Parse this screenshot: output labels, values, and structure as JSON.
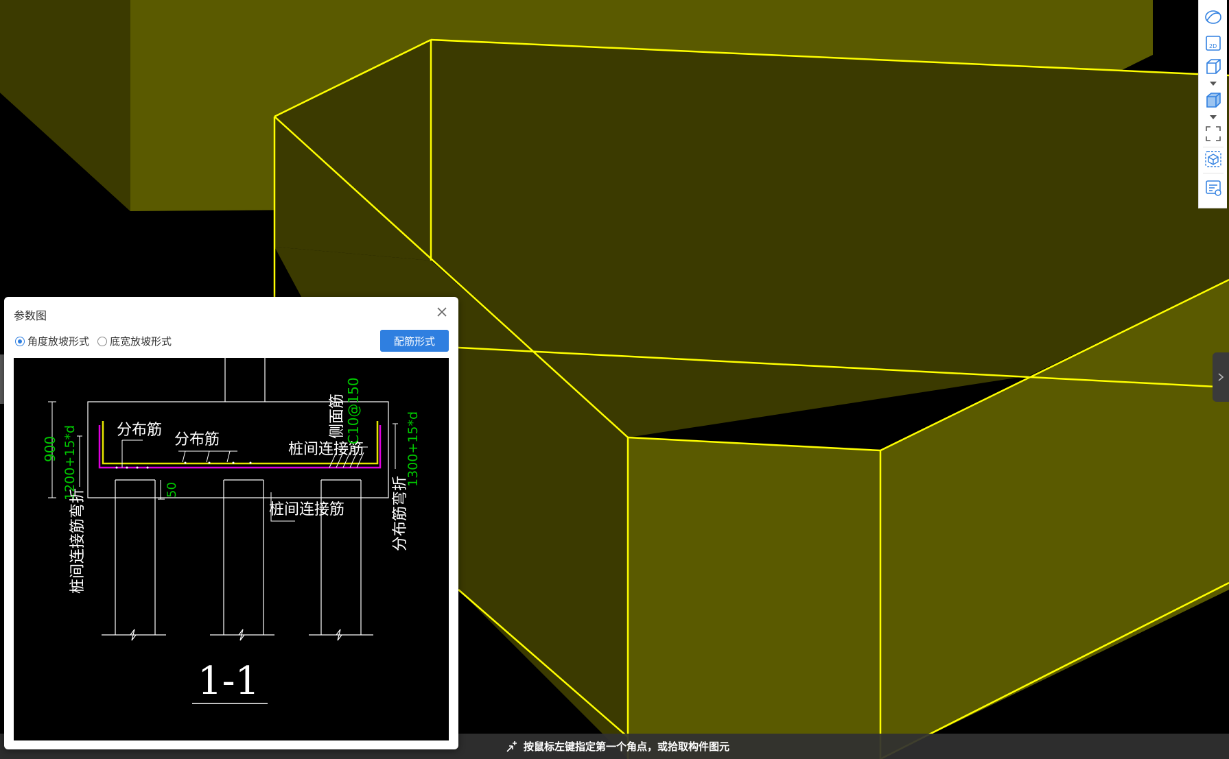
{
  "dialog": {
    "title": "参数图",
    "radio_options": [
      {
        "label": "角度放坡形式",
        "selected": true
      },
      {
        "label": "底宽放坡形式",
        "selected": false
      }
    ],
    "rebar_form_button_label": "配筋形式"
  },
  "diagram": {
    "labels": {
      "distribution_bar_1": "分布筋",
      "distribution_bar_2": "分布筋",
      "pile_connection_bar_top": "桩间连接筋",
      "pile_connection_bar_bottom": "桩间连接筋",
      "side_face_bar": "侧面筋",
      "side_face_spec": "C10@150",
      "left_vertical_bend": "桩间连接筋弯折",
      "right_vertical_bend": "分布筋弯折",
      "section_title": "1-1"
    },
    "dimensions": {
      "height": "900",
      "left_bend_length": "1200+15*d",
      "right_bend_length": "1300+15*d",
      "cover": "50"
    }
  },
  "status_bar": {
    "hint": "按鼠标左键指定第一个角点，或拾取构件图元"
  },
  "toolbar": {
    "icons": [
      "orbit-icon",
      "view-2d-icon",
      "view-3d-box-icon",
      "dropdown-caret-icon",
      "shaded-cube-icon",
      "dropdown-caret-icon",
      "fullscreen-icon",
      "cube-select-icon",
      "property-list-icon"
    ],
    "view_2d_text": "2D"
  },
  "colors": {
    "model_fill_light": "#5a5a00",
    "model_fill_dark": "#3b3a00",
    "edge_highlight": "#ffff00",
    "accent_blue": "#2f7fe0",
    "rebar_yellow": "#e6e600",
    "rebar_magenta": "#e000e0",
    "dim_green": "#00c800"
  }
}
